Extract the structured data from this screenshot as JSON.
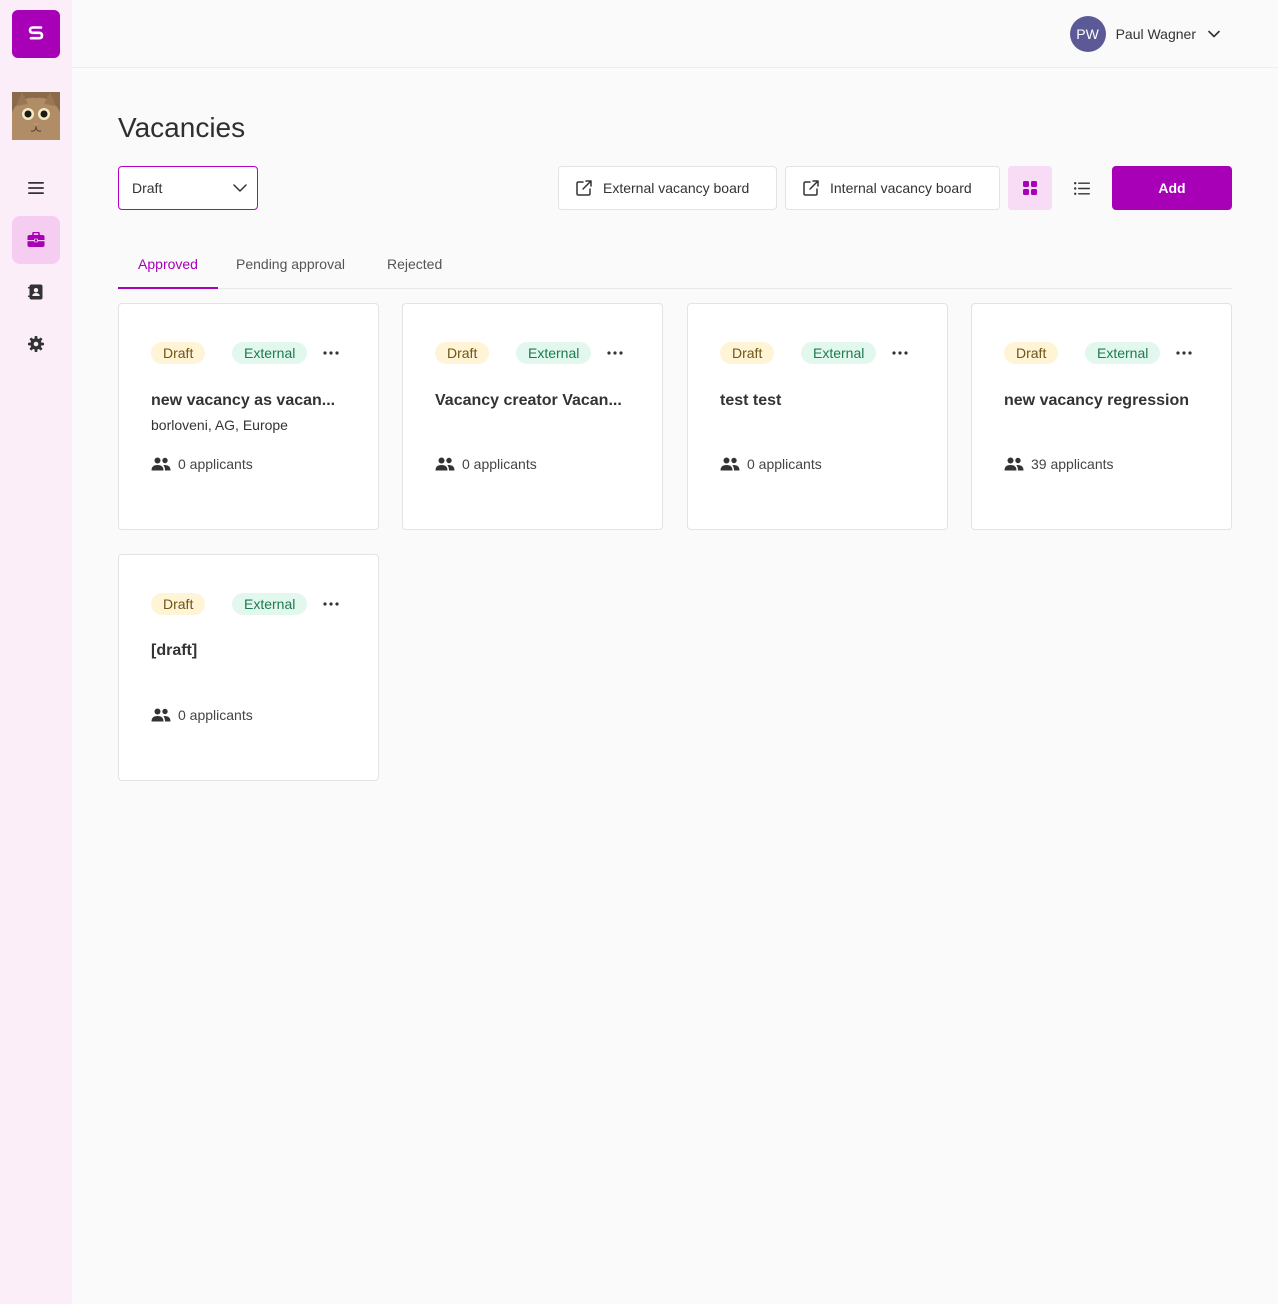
{
  "user": {
    "initials": "PW",
    "name": "Paul Wagner"
  },
  "page": {
    "title": "Vacancies"
  },
  "filter": {
    "selected": "Draft"
  },
  "toolbar": {
    "external_board": "External vacancy board",
    "internal_board": "Internal vacancy board",
    "add": "Add"
  },
  "tabs": [
    {
      "label": "Approved",
      "active": true
    },
    {
      "label": "Pending approval",
      "active": false
    },
    {
      "label": "Rejected",
      "active": false
    }
  ],
  "colors": {
    "accent": "#a700b7",
    "sidebar_bg": "#fbeef9",
    "avatar_bg": "#5b5a97"
  },
  "cards": [
    {
      "status": "Draft",
      "type": "External",
      "title": "new vacancy as vacan...",
      "location": "borloveni, AG, Europe",
      "applicants": "0 applicants"
    },
    {
      "status": "Draft",
      "type": "External",
      "title": "Vacancy creator Vacan...",
      "location": "",
      "applicants": "0 applicants"
    },
    {
      "status": "Draft",
      "type": "External",
      "title": "test test",
      "location": "",
      "applicants": "0 applicants"
    },
    {
      "status": "Draft",
      "type": "External",
      "title": "new vacancy regression",
      "location": "",
      "applicants": "39 applicants"
    },
    {
      "status": "Draft",
      "type": "External",
      "title": "[draft]",
      "location": "",
      "applicants": "0 applicants"
    }
  ]
}
